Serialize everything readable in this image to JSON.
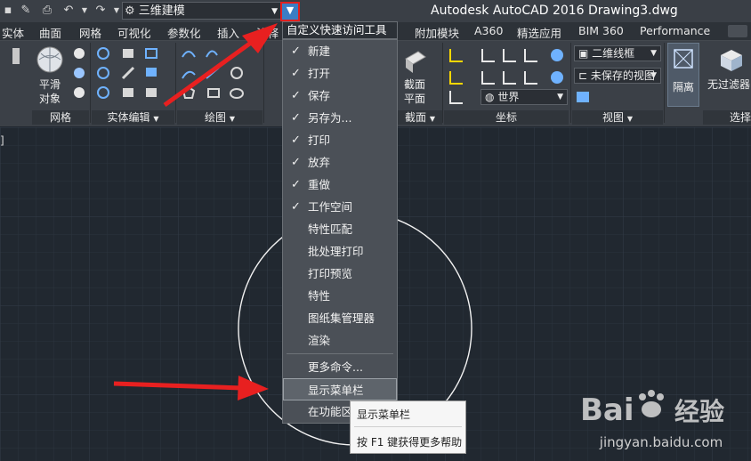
{
  "titlebar": {
    "workspace": "三维建模",
    "app_title": "Autodesk AutoCAD 2016    Drawing3.dwg"
  },
  "tabs": [
    "实体",
    "曲面",
    "网格",
    "可视化",
    "参数化",
    "插入",
    "注释",
    "附加模块",
    "A360",
    "精选应用",
    "BIM 360",
    "Performance"
  ],
  "ribbon": {
    "smooth_label_1": "平滑",
    "smooth_label_2": "对象",
    "mesh_panel": "网格",
    "solid_edit_panel": "实体编辑",
    "draw_panel": "绘图",
    "section_label_1": "截面",
    "section_label_2": "平面",
    "section_panel": "截面",
    "coord_panel": "坐标",
    "world_combo": "世界",
    "visual_style_combo": "二维线框",
    "view_combo": "未保存的视图",
    "view_panel": "视图",
    "isolate_label": "隔离",
    "no_filter_label": "无过滤器",
    "select_panel": "选择"
  },
  "menu": {
    "header": "自定义快速访问工具栏",
    "items": [
      {
        "label": "新建",
        "checked": true
      },
      {
        "label": "打开",
        "checked": true
      },
      {
        "label": "保存",
        "checked": true
      },
      {
        "label": "另存为...",
        "checked": true
      },
      {
        "label": "打印",
        "checked": true
      },
      {
        "label": "放弃",
        "checked": true
      },
      {
        "label": "重做",
        "checked": true
      },
      {
        "label": "工作空间",
        "checked": true
      },
      {
        "label": "特性匹配",
        "checked": false
      },
      {
        "label": "批处理打印",
        "checked": false
      },
      {
        "label": "打印预览",
        "checked": false
      },
      {
        "label": "特性",
        "checked": false
      },
      {
        "label": "图纸集管理器",
        "checked": false
      },
      {
        "label": "渲染",
        "checked": false
      }
    ],
    "more_commands": "更多命令...",
    "show_menubar": "显示菜单栏",
    "below_ribbon": "在功能区"
  },
  "tooltip": {
    "title": "显示菜单栏",
    "help": "按 F1 键获得更多帮助"
  },
  "watermark": {
    "text": "jingyan.baidu.com",
    "logo": "Bai 经验"
  },
  "colors": {
    "highlight_red": "#e02020",
    "accent_blue": "#3a7dc4",
    "canvas_bg": "#212830"
  }
}
